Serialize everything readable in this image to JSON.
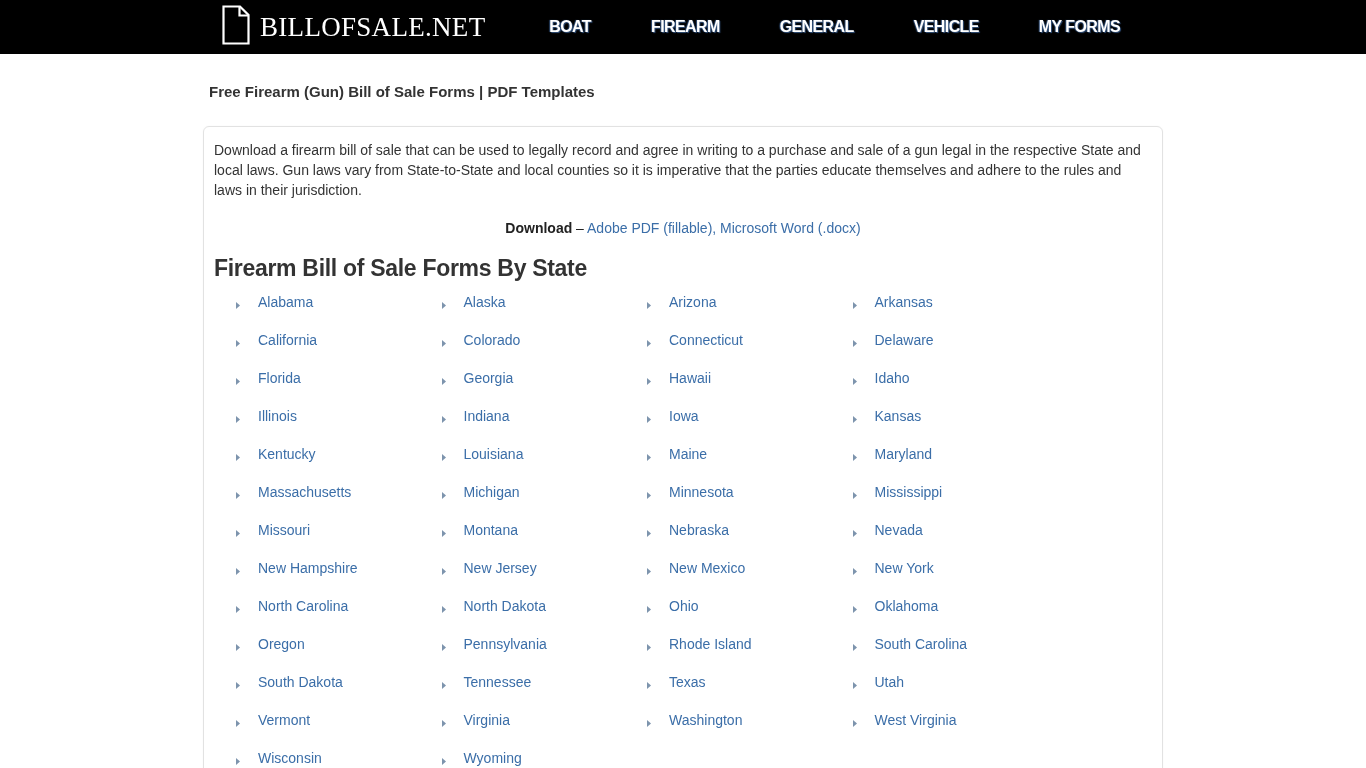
{
  "header": {
    "logo": "BILLOFSALE.NET",
    "nav": [
      "BOAT",
      "FIREARM",
      "GENERAL",
      "VEHICLE",
      "MY FORMS"
    ]
  },
  "page_title": "Free Firearm (Gun) Bill of Sale Forms | PDF Templates",
  "intro": "Download a firearm bill of sale that can be used to legally record and agree in writing to a purchase and sale of a gun legal in the respective State and local laws. Gun laws vary from State-to-State and local counties so it is imperative that the parties educate themselves and adhere to the rules and laws in their jurisdiction.",
  "download": {
    "label": "Download",
    "separator": "–",
    "links": [
      "Adobe PDF (fillable),",
      "Microsoft Word (.docx)"
    ]
  },
  "states_heading": "Firearm Bill of Sale Forms By State",
  "states": [
    "Alabama",
    "Alaska",
    "Arizona",
    "Arkansas",
    "California",
    "Colorado",
    "Connecticut",
    "Delaware",
    "Florida",
    "Georgia",
    "Hawaii",
    "Idaho",
    "Illinois",
    "Indiana",
    "Iowa",
    "Kansas",
    "Kentucky",
    "Louisiana",
    "Maine",
    "Maryland",
    "Massachusetts",
    "Michigan",
    "Minnesota",
    "Mississippi",
    "Missouri",
    "Montana",
    "Nebraska",
    "Nevada",
    "New Hampshire",
    "New Jersey",
    "New Mexico",
    "New York",
    "North Carolina",
    "North Dakota",
    "Ohio",
    "Oklahoma",
    "Oregon",
    "Pennsylvania",
    "Rhode Island",
    "South Carolina",
    "South Dakota",
    "Tennessee",
    "Texas",
    "Utah",
    "Vermont",
    "Virginia",
    "Washington",
    "West Virginia",
    "Wisconsin",
    "Wyoming"
  ]
}
